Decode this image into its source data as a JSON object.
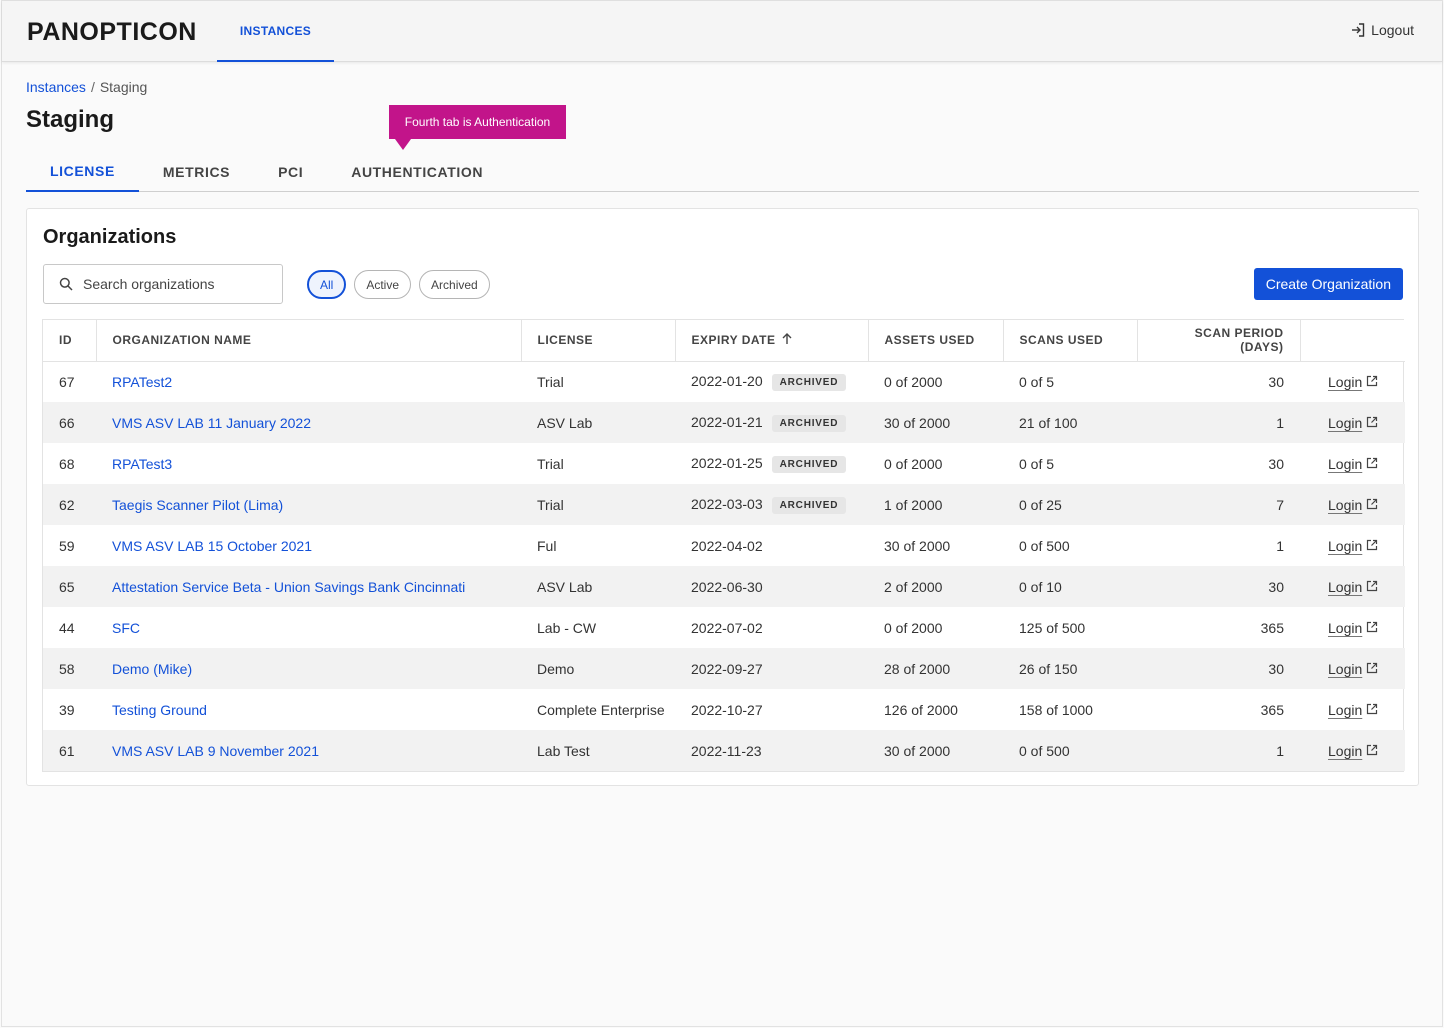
{
  "app": {
    "brand": "PANOPTICON",
    "nav_instances": "INSTANCES",
    "logout": "Logout"
  },
  "breadcrumb": {
    "root": "Instances",
    "separator": "/",
    "current": "Staging"
  },
  "page": {
    "title": "Staging"
  },
  "tooltip": {
    "text": "Fourth tab is Authentication"
  },
  "tabs": [
    {
      "label": "LICENSE"
    },
    {
      "label": "METRICS"
    },
    {
      "label": "PCI"
    },
    {
      "label": "AUTHENTICATION"
    }
  ],
  "organizations": {
    "title": "Organizations",
    "search_placeholder": "Search organizations",
    "filters": [
      "All",
      "Active",
      "Archived"
    ],
    "create_label": "Create Organization",
    "columns": [
      "ID",
      "ORGANIZATION NAME",
      "LICENSE",
      "EXPIRY DATE",
      "ASSETS USED",
      "SCANS USED",
      "SCAN PERIOD (DAYS)",
      ""
    ],
    "archived_label": "ARCHIVED",
    "login_label": "Login",
    "rows": [
      {
        "id": "67",
        "name": "RPATest2",
        "license": "Trial",
        "expiry": "2022-01-20",
        "archived": true,
        "assets": "0 of 2000",
        "scans": "0 of 5",
        "period": "30"
      },
      {
        "id": "66",
        "name": "VMS ASV LAB 11 January 2022",
        "license": "ASV Lab",
        "expiry": "2022-01-21",
        "archived": true,
        "assets": "30 of 2000",
        "scans": "21 of 100",
        "period": "1"
      },
      {
        "id": "68",
        "name": "RPATest3",
        "license": "Trial",
        "expiry": "2022-01-25",
        "archived": true,
        "assets": "0 of 2000",
        "scans": "0 of 5",
        "period": "30"
      },
      {
        "id": "62",
        "name": "Taegis Scanner Pilot (Lima)",
        "license": "Trial",
        "expiry": "2022-03-03",
        "archived": true,
        "assets": "1 of 2000",
        "scans": "0 of 25",
        "period": "7"
      },
      {
        "id": "59",
        "name": "VMS ASV LAB 15 October 2021",
        "license": "Ful",
        "expiry": "2022-04-02",
        "archived": false,
        "assets": "30 of 2000",
        "scans": "0 of 500",
        "period": "1"
      },
      {
        "id": "65",
        "name": "Attestation Service Beta - Union Savings Bank Cincinnati",
        "license": "ASV Lab",
        "expiry": "2022-06-30",
        "archived": false,
        "assets": "2 of 2000",
        "scans": "0 of 10",
        "period": "30"
      },
      {
        "id": "44",
        "name": "SFC",
        "license": "Lab - CW",
        "expiry": "2022-07-02",
        "archived": false,
        "assets": "0 of 2000",
        "scans": "125 of 500",
        "period": "365"
      },
      {
        "id": "58",
        "name": "Demo (Mike)",
        "license": "Demo",
        "expiry": "2022-09-27",
        "archived": false,
        "assets": "28 of 2000",
        "scans": "26 of 150",
        "period": "30"
      },
      {
        "id": "39",
        "name": "Testing Ground",
        "license": "Complete Enterprise",
        "expiry": "2022-10-27",
        "archived": false,
        "assets": "126 of 2000",
        "scans": "158 of 1000",
        "period": "365"
      },
      {
        "id": "61",
        "name": "VMS ASV LAB 9 November 2021",
        "license": "Lab Test",
        "expiry": "2022-11-23",
        "archived": false,
        "assets": "30 of 2000",
        "scans": "0 of 500",
        "period": "1"
      }
    ]
  },
  "icons": {
    "logout": "logout-icon",
    "search": "search-icon",
    "sort": "arrow-up-icon",
    "external": "external-link-icon"
  },
  "colors": {
    "accent": "#1351d8",
    "tooltip": "#c2148a",
    "stripe": "#f2f2f2"
  }
}
